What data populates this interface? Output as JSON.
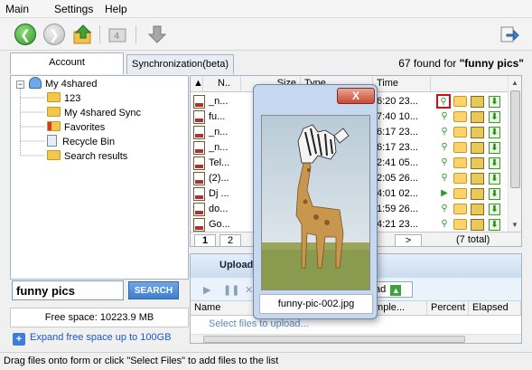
{
  "menu": [
    "Main",
    "Settings",
    "Help"
  ],
  "toolbar": {
    "icons": [
      "back-icon",
      "forward-icon",
      "up-folder-icon",
      "sync-icon",
      "download-icon",
      "export-icon"
    ],
    "colors": {
      "back": "#3aa33a",
      "forward": "#b8b8b8"
    }
  },
  "tabs": {
    "account": "Account",
    "sync": "Synchronization(beta)"
  },
  "found": {
    "count": "67 found for",
    "query": "\"funny pics\""
  },
  "tree": {
    "root": "My 4shared",
    "items": [
      "123",
      "My 4shared Sync",
      "Favorites",
      "Recycle Bin",
      "Search results"
    ]
  },
  "search": {
    "value": "funny pics",
    "button": "SEARCH"
  },
  "free_space": "Free space: 10223.9 MB",
  "expand_link": "Expand free space up to 100GB",
  "grid": {
    "columns": [
      "N..",
      "Size",
      "Type",
      "Time"
    ],
    "rows": [
      {
        "name": "_n...",
        "time": "6:20 23..."
      },
      {
        "name": "fu...",
        "time": "7:40 10..."
      },
      {
        "name": "_n...",
        "time": "6:17 23..."
      },
      {
        "name": "_n...",
        "time": "6:17 23..."
      },
      {
        "name": "Tel...",
        "time": "2:41 05..."
      },
      {
        "name": "(2)...",
        "time": "2:05 26..."
      },
      {
        "name": "Dj ...",
        "time": "4:01 02..."
      },
      {
        "name": "do...",
        "time": "1:59 26..."
      },
      {
        "name": "Go...",
        "time": "4:21 23..."
      }
    ],
    "pages": [
      "1",
      "2"
    ],
    "next": ">",
    "total": "(7 total)"
  },
  "upload": {
    "title": "Upload",
    "button": "ad",
    "columns": [
      "Name",
      "Comple...",
      "Percent",
      "Elapsed"
    ],
    "hint": "Select files to upload..."
  },
  "status": "Drag files onto form or click \"Select Files\" to add files to the list",
  "popup": {
    "close": "X",
    "caption": "funny-pic-002.jpg"
  }
}
